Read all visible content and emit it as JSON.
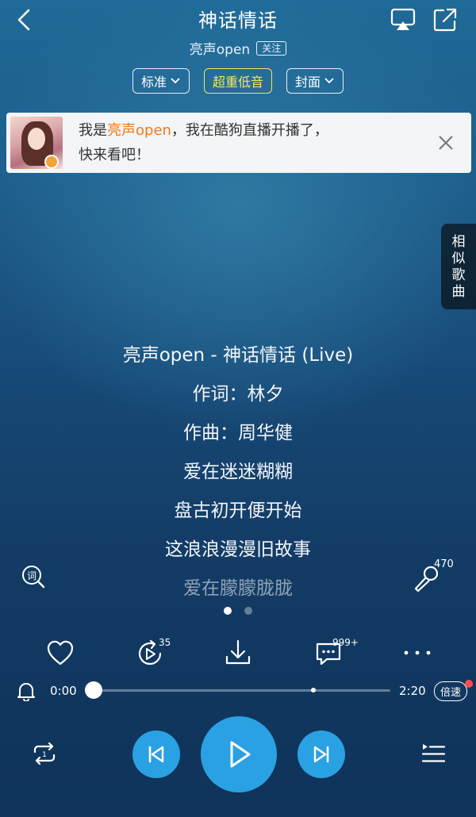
{
  "header": {
    "title": "神话情话",
    "artist": "亮声open",
    "follow_label": "关注"
  },
  "chips": [
    {
      "label": "标准",
      "has_dropdown": true
    },
    {
      "label": "超重低音",
      "highlighted": true
    },
    {
      "label": "封面",
      "has_dropdown": true
    }
  ],
  "banner": {
    "text_prefix": "我是",
    "text_highlight": "亮声open",
    "text_suffix": "，我在酷狗直播开播了，",
    "text_line2": "快来看吧！"
  },
  "side_tab": {
    "label_chars": [
      "相",
      "似",
      "歌",
      "曲"
    ]
  },
  "lyrics": [
    "亮声open - 神话情话 (Live)",
    "作词：林夕",
    "作曲：周华健",
    "爱在迷迷糊糊",
    "盘古初开便开始",
    "这浪浪漫漫旧故事",
    "爱在朦朦胧胧"
  ],
  "mic_count": "470",
  "pager": {
    "count": 2,
    "active": 0
  },
  "actions": {
    "replay_count": "35",
    "comment_count": "999+"
  },
  "progress": {
    "current": "0:00",
    "total": "2:20",
    "fraction": 0.0,
    "buffered_fraction": 0.74
  },
  "speed_label": "倍速",
  "colors": {
    "accent": "#2aa1e2",
    "highlight_chip": "#f4e65a",
    "banner_highlight": "#f07a1a",
    "notify_dot": "#ff4b4b"
  }
}
